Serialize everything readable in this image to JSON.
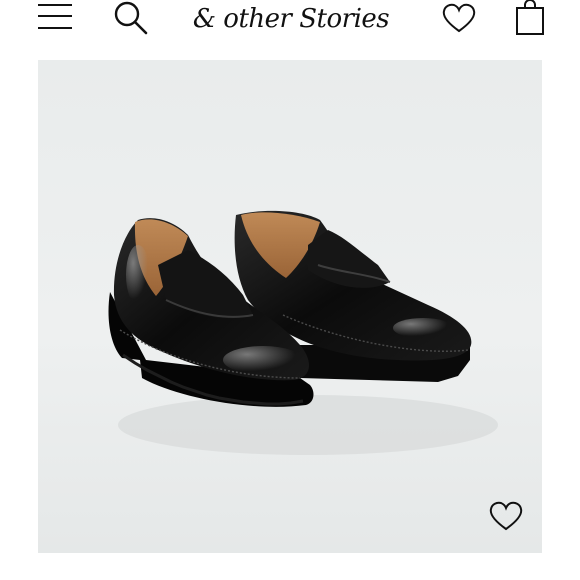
{
  "header": {
    "menu_icon": "hamburger-menu-icon",
    "search_icon": "search-icon",
    "logo_text": "& other Stories",
    "wishlist_icon": "heart-outline-icon",
    "bag_icon": "shopping-bag-icon"
  },
  "product": {
    "image": "black-leather-chunky-loafers-photo",
    "wishlist_icon": "heart-outline-icon"
  },
  "colors": {
    "background": "#ffffff",
    "image_background": "#eceeee",
    "icon": "#111111"
  }
}
